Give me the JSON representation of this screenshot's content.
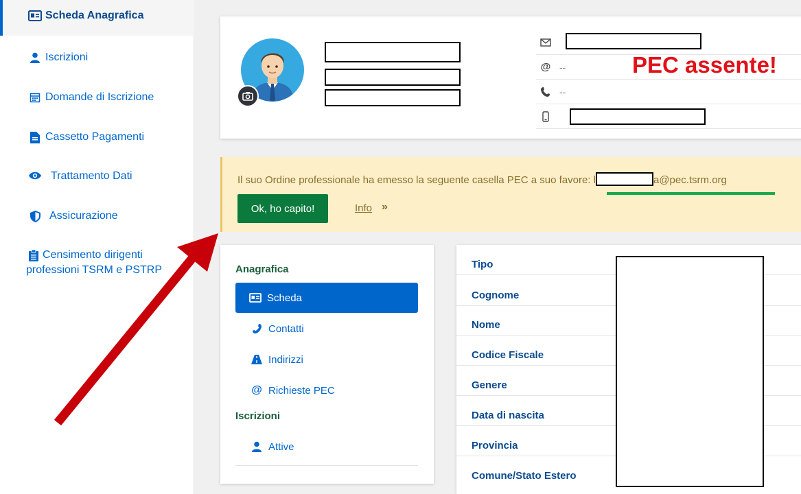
{
  "sidebar": {
    "items": [
      {
        "label": "Scheda Anagrafica",
        "icon": "id-card-icon"
      },
      {
        "label": "Iscrizioni",
        "icon": "user-icon"
      },
      {
        "label": "Domande di Iscrizione",
        "icon": "calendar-icon"
      },
      {
        "label": "Cassetto Pagamenti",
        "icon": "document-icon"
      },
      {
        "label": "Trattamento Dati",
        "icon": "eye-icon"
      },
      {
        "label": "Assicurazione",
        "icon": "shield-icon"
      },
      {
        "label": "Censimento dirigenti professioni TSRM e PSTRP",
        "icon": "clipboard-icon"
      }
    ]
  },
  "profile": {
    "contacts": [
      {
        "icon": "envelope-icon",
        "value": ""
      },
      {
        "icon": "at-icon",
        "value": "--"
      },
      {
        "icon": "phone-icon",
        "value": "--"
      },
      {
        "icon": "mobile-icon",
        "value": ""
      }
    ],
    "pec_annotation": "PEC assente!"
  },
  "banner": {
    "text_prefix": "Il suo Ordine professionale ha emesso la seguente casella PEC a suo favore: l",
    "text_suffix": "a@pec.tsrm.org",
    "ok_label": "Ok, ho capito!",
    "info_label": "Info",
    "info_chevron": "»"
  },
  "nav": {
    "anagrafica_header": "Anagrafica",
    "items": [
      {
        "label": "Scheda",
        "icon": "id-card-icon"
      },
      {
        "label": "Contatti",
        "icon": "phone-icon"
      },
      {
        "label": "Indirizzi",
        "icon": "road-icon"
      },
      {
        "label": "Richieste PEC",
        "icon": "at-icon"
      }
    ],
    "iscrizioni_header": "Iscrizioni",
    "iscrizioni_items": [
      {
        "label": "Attive",
        "icon": "user-icon"
      }
    ]
  },
  "details": {
    "fields": [
      "Tipo",
      "Cognome",
      "Nome",
      "Codice Fiscale",
      "Genere",
      "Data di nascita",
      "Provincia",
      "Comune/Stato Estero"
    ]
  },
  "colors": {
    "primary": "#0066cc",
    "success": "#0a7a3d",
    "warning_bg": "#fdf0c8",
    "annotation_red": "#e0121a"
  }
}
